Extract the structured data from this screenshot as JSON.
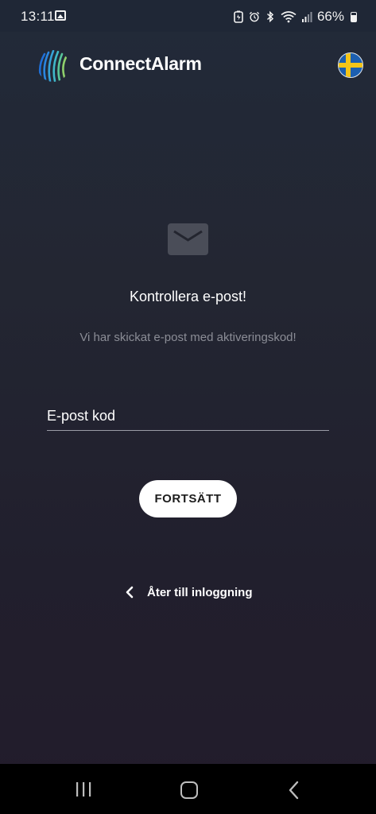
{
  "status_bar": {
    "time": "13:11",
    "battery_percent": "66%",
    "icons": [
      "gallery-icon",
      "battery-saver-icon",
      "alarm-icon",
      "bluetooth-icon",
      "wifi-icon",
      "signal-icon",
      "battery-icon"
    ]
  },
  "app_bar": {
    "brand": "ConnectAlarm",
    "language_flag": "sweden-flag-icon"
  },
  "main": {
    "icon": "mail-icon",
    "title": "Kontrollera e-post!",
    "subtitle": "Vi har skickat e-post med aktiveringskod!",
    "code_field": {
      "placeholder": "E-post kod",
      "value": ""
    },
    "continue_label": "FORTSÄTT",
    "back_label": "Åter till inloggning"
  },
  "colors": {
    "background": "#222a39",
    "text": "#ffffff",
    "muted_text": "#8b8d96",
    "button_bg": "#ffffff",
    "flag_blue": "#1c5fb0",
    "flag_yellow": "#f5c518"
  }
}
